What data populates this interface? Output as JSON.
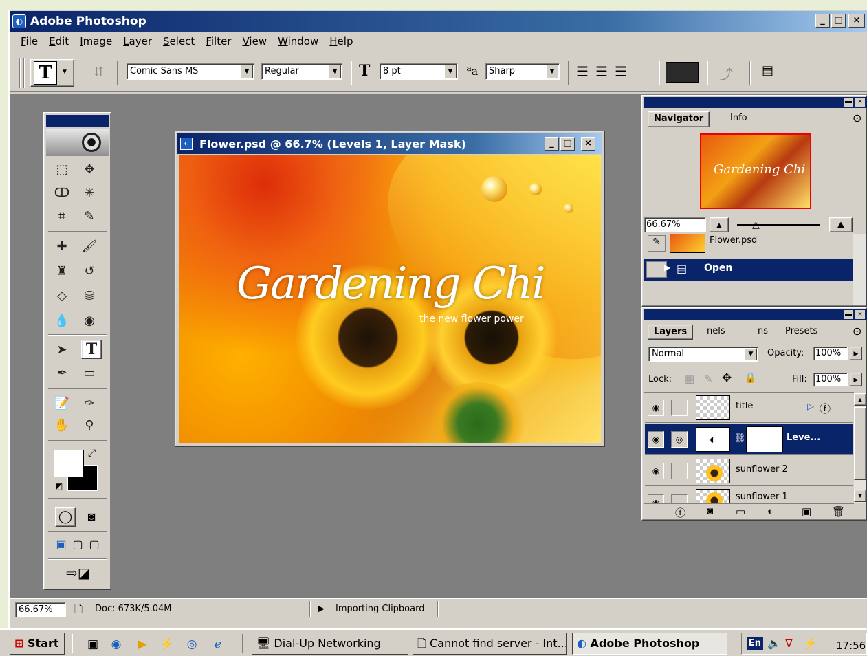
{
  "app": {
    "title": "Adobe Photoshop",
    "win_buttons": [
      "_",
      "□",
      "×"
    ]
  },
  "menu": [
    "File",
    "Edit",
    "Image",
    "Layer",
    "Select",
    "Filter",
    "View",
    "Window",
    "Help"
  ],
  "options": {
    "tool_glyph": "T",
    "font_family": "Comic Sans MS",
    "font_style": "Regular",
    "font_size": "8 pt",
    "aa_label": "ªa",
    "antialias": "Sharp",
    "color_swatch": "#2a2a2a"
  },
  "document": {
    "title": "Flower.psd @ 66.7% (Levels 1, Layer Mask)",
    "art_title": "Gardening Chi",
    "art_subtitle": "the new flower power"
  },
  "navigator": {
    "tabs": [
      "Navigator",
      "Info"
    ],
    "zoom": "66.67%",
    "thumb_text": "Gardening Chi"
  },
  "history": {
    "file": "Flower.psd",
    "current": "Open"
  },
  "layers": {
    "tabs": [
      "Layers",
      "nels",
      "ns",
      "Presets"
    ],
    "blend_mode": "Normal",
    "opacity_label": "Opacity:",
    "opacity": "100%",
    "lock_label": "Lock:",
    "fill_label": "Fill:",
    "fill": "100%",
    "rows": [
      {
        "name": "title",
        "selected": false
      },
      {
        "name": "Leve...",
        "selected": true
      },
      {
        "name": "sunflower 2",
        "selected": false
      },
      {
        "name": "sunflower 1",
        "selected": false
      }
    ]
  },
  "statusbar": {
    "zoom": "66.67%",
    "doc": "Doc: 673K/5.04M",
    "message": "Importing Clipboard"
  },
  "taskbar": {
    "start": "Start",
    "tasks": [
      "Dial-Up Networking",
      "Cannot find server - Int...",
      "Adobe Photoshop"
    ],
    "lang": "En",
    "clock": "17:56"
  },
  "colors": {
    "titlebar": "#0a246a",
    "face": "#d4d0c8",
    "workspace": "#808080",
    "selection": "#0a246a"
  }
}
